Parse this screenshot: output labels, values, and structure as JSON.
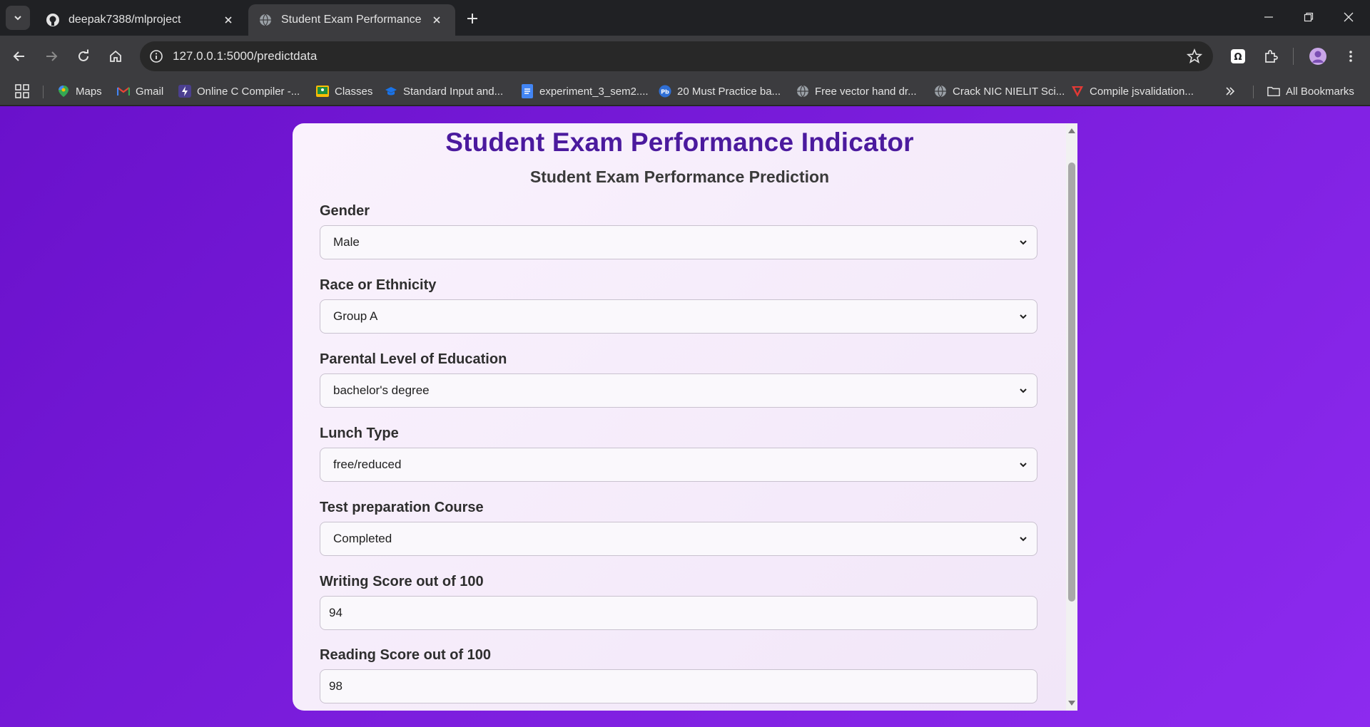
{
  "browser": {
    "tabs": [
      {
        "title": "deepak7388/mlproject",
        "icon": "github-icon",
        "active": false
      },
      {
        "title": "Student Exam Performance",
        "icon": "globe-icon",
        "active": true
      }
    ],
    "url": "127.0.0.1:5000/predictdata",
    "bookmarks": [
      {
        "label": "Maps",
        "icon": "maps-pin-icon"
      },
      {
        "label": "Gmail",
        "icon": "gmail-icon"
      },
      {
        "label": "Online C Compiler -...",
        "icon": "bolt-icon"
      },
      {
        "label": "Classes",
        "icon": "classroom-icon"
      },
      {
        "label": "Standard Input and...",
        "icon": "graduation-cap-icon"
      },
      {
        "label": "experiment_3_sem2....",
        "icon": "docs-icon"
      },
      {
        "label": "20 Must Practice ba...",
        "icon": "pb-icon"
      },
      {
        "label": "Free vector hand dr...",
        "icon": "globe-icon"
      },
      {
        "label": "Crack NIC NIELIT Sci...",
        "icon": "globe-icon"
      },
      {
        "label": "Compile jsvalidation...",
        "icon": "red-v-icon"
      }
    ],
    "all_bookmarks_label": "All Bookmarks"
  },
  "page": {
    "title": "Student Exam Performance Indicator",
    "subtitle": "Student Exam Performance Prediction",
    "fields": [
      {
        "label": "Gender",
        "type": "select",
        "value": "Male"
      },
      {
        "label": "Race or Ethnicity",
        "type": "select",
        "value": "Group A"
      },
      {
        "label": "Parental Level of Education",
        "type": "select",
        "value": "bachelor's degree"
      },
      {
        "label": "Lunch Type",
        "type": "select",
        "value": "free/reduced"
      },
      {
        "label": "Test preparation Course",
        "type": "select",
        "value": "Completed"
      },
      {
        "label": "Writing Score out of 100",
        "type": "input",
        "value": "94"
      },
      {
        "label": "Reading Score out of 100",
        "type": "input",
        "value": "98"
      }
    ]
  },
  "colors": {
    "page_gradient_start": "#6a11cb",
    "page_gradient_end": "#8d2aef",
    "title_color": "#4b1a9e"
  }
}
